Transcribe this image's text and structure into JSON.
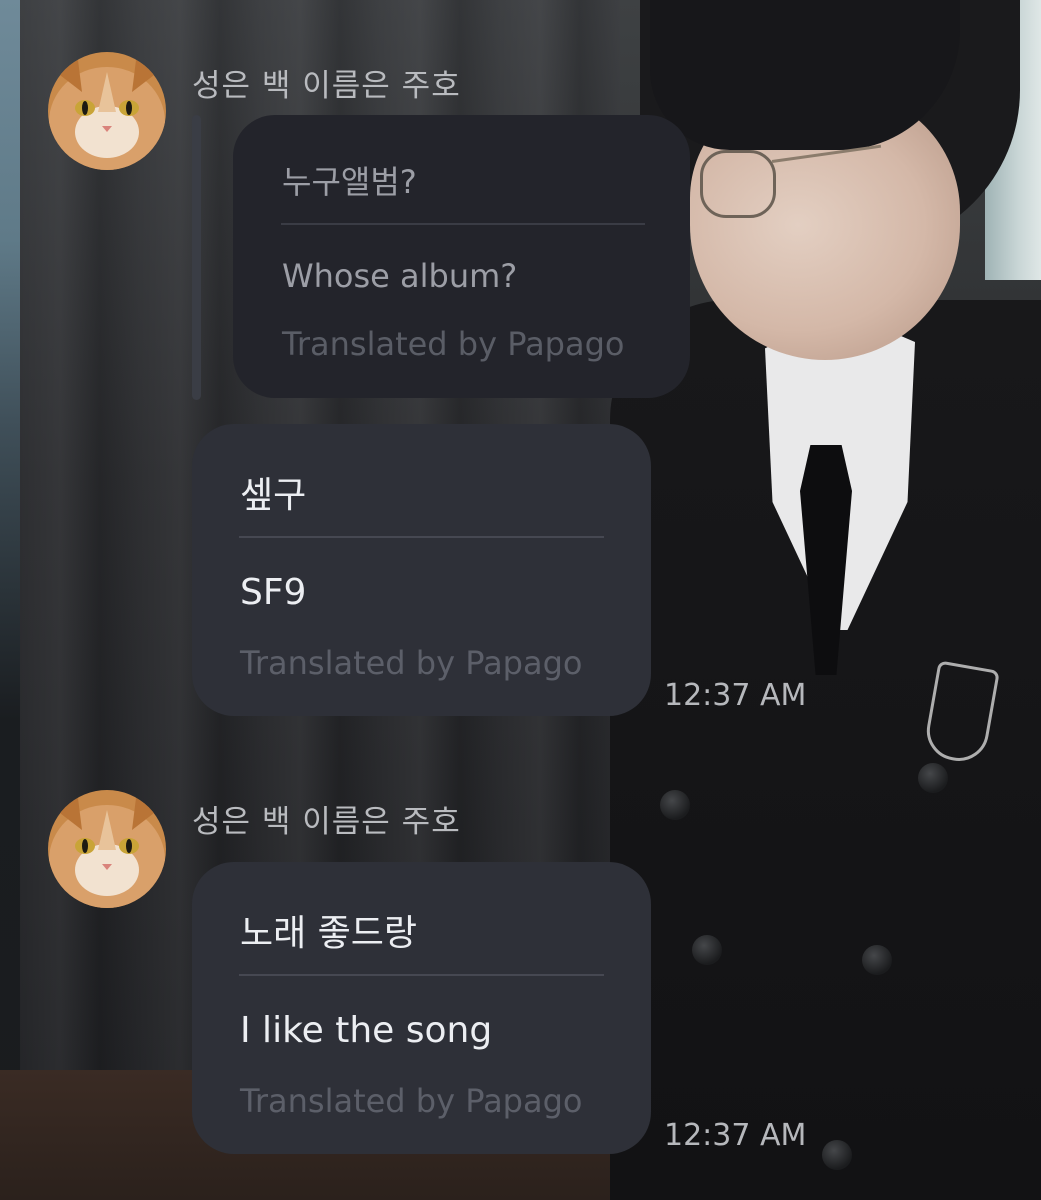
{
  "messages": [
    {
      "sender": "성은 백 이름은 주호",
      "avatar_icon": "orange-cat-avatar-icon",
      "quoted": {
        "original": "누구앨범?",
        "translation": "Whose album?",
        "credit": "Translated by Papago"
      },
      "bubble": {
        "original": "셒구",
        "translation": "SF9",
        "credit": "Translated by Papago"
      },
      "time": "12:37 AM"
    },
    {
      "sender": "성은 백 이름은 주호",
      "avatar_icon": "orange-cat-avatar-icon",
      "bubble": {
        "original": "노래 좋드랑",
        "translation": "I like the song",
        "credit": "Translated by Papago"
      },
      "time": "12:37 AM"
    }
  ],
  "colors": {
    "bubble_main": "#2e3038",
    "bubble_quoted": "#23242b",
    "text_primary": "#eceef2",
    "text_muted": "#5c5f69"
  }
}
